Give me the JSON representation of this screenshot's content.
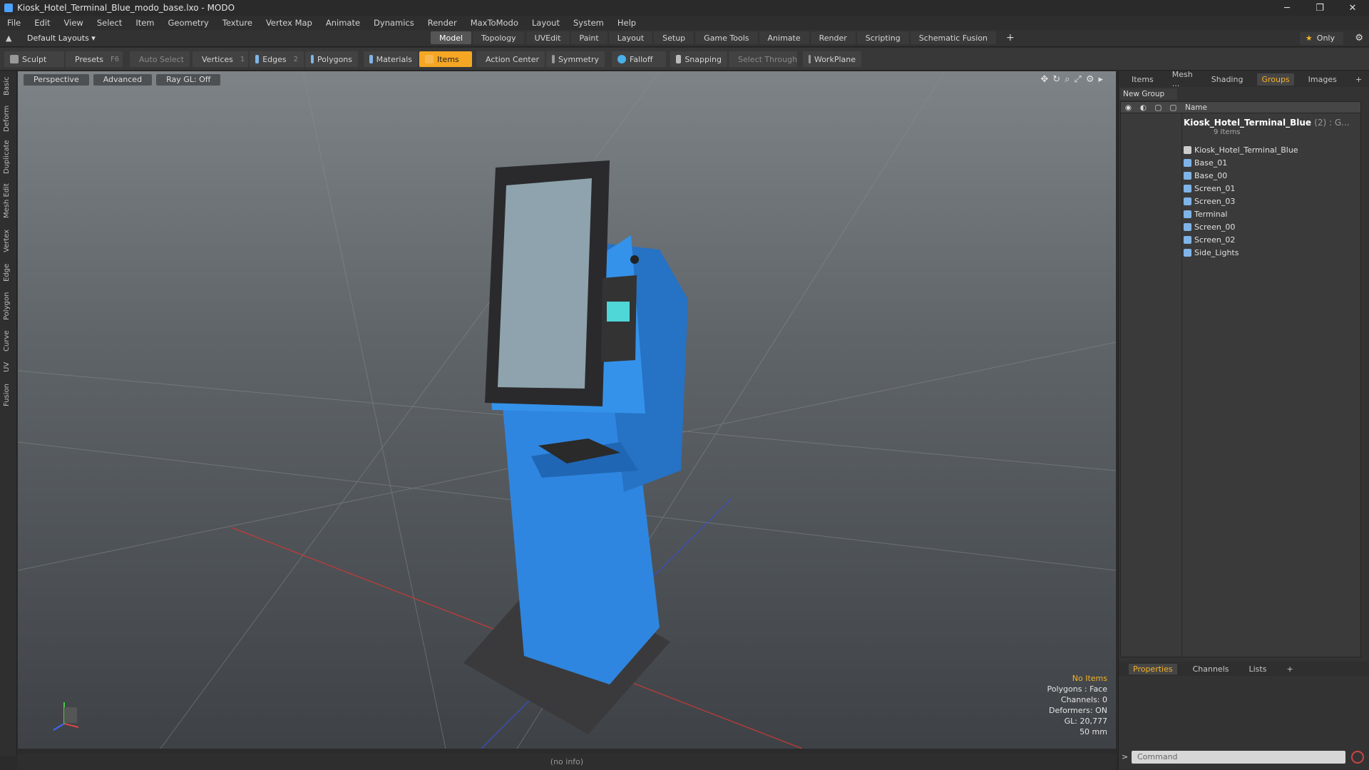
{
  "window": {
    "title": "Kiosk_Hotel_Terminal_Blue_modo_base.lxo - MODO",
    "min": "─",
    "max": "❐",
    "close": "✕"
  },
  "menu": [
    "File",
    "Edit",
    "View",
    "Select",
    "Item",
    "Geometry",
    "Texture",
    "Vertex Map",
    "Animate",
    "Dynamics",
    "Render",
    "MaxToModo",
    "Layout",
    "System",
    "Help"
  ],
  "layoutbar": {
    "layouts": "Default Layouts ▾",
    "tabs": [
      "Model",
      "Topology",
      "UVEdit",
      "Paint",
      "Layout",
      "Setup",
      "Game Tools",
      "Animate",
      "Render",
      "Scripting",
      "Schematic Fusion"
    ],
    "active_tab": "Model",
    "plus": "+",
    "only": "Only"
  },
  "toolbar": {
    "sculpt": "Sculpt",
    "presets": "Presets",
    "presets_key": "F6",
    "auto_select": "Auto Select",
    "vertices": "Vertices",
    "vertices_key": "1",
    "edges": "Edges",
    "edges_key": "2",
    "polygons": "Polygons",
    "materials": "Materials",
    "items": "Items",
    "action_center": "Action Center",
    "symmetry": "Symmetry",
    "falloff": "Falloff",
    "snapping": "Snapping",
    "select_through": "Select Through",
    "workplane": "WorkPlane"
  },
  "lefttabs": [
    "Basic",
    "Deform",
    "Duplicate",
    "Mesh Edit",
    "Vertex",
    "Edge",
    "Polygon",
    "Curve",
    "UV",
    "Fusion"
  ],
  "viewport": {
    "view": "Perspective",
    "shading": "Advanced",
    "raygl": "Ray GL: Off",
    "hud": {
      "title": "No Items",
      "polygons": "Polygons : Face",
      "channels": "Channels: 0",
      "deformers": "Deformers: ON",
      "gl": "GL: 20,777",
      "lens": "50 mm"
    }
  },
  "status": "(no info)",
  "rightpanel": {
    "tabs": [
      "Items",
      "Mesh ...",
      "Shading",
      "Groups",
      "Images"
    ],
    "active_tab": "Groups",
    "plus": "+",
    "new_group": "New Group",
    "name_col": "Name",
    "root": {
      "name": "Kiosk_Hotel_Terminal_Blue",
      "count": "(2) : G...",
      "sub": "9 Items"
    },
    "items": [
      "Kiosk_Hotel_Terminal_Blue",
      "Base_01",
      "Base_00",
      "Screen_01",
      "Screen_03",
      "Terminal",
      "Screen_00",
      "Screen_02",
      "Side_Lights"
    ],
    "bottom_tabs": [
      "Properties",
      "Channels",
      "Lists"
    ],
    "bottom_active": "Properties",
    "command_placeholder": "Command"
  },
  "colors": {
    "accent": "#f5a623",
    "kiosk_blue": "#2f86e0",
    "panel": "#333333"
  }
}
